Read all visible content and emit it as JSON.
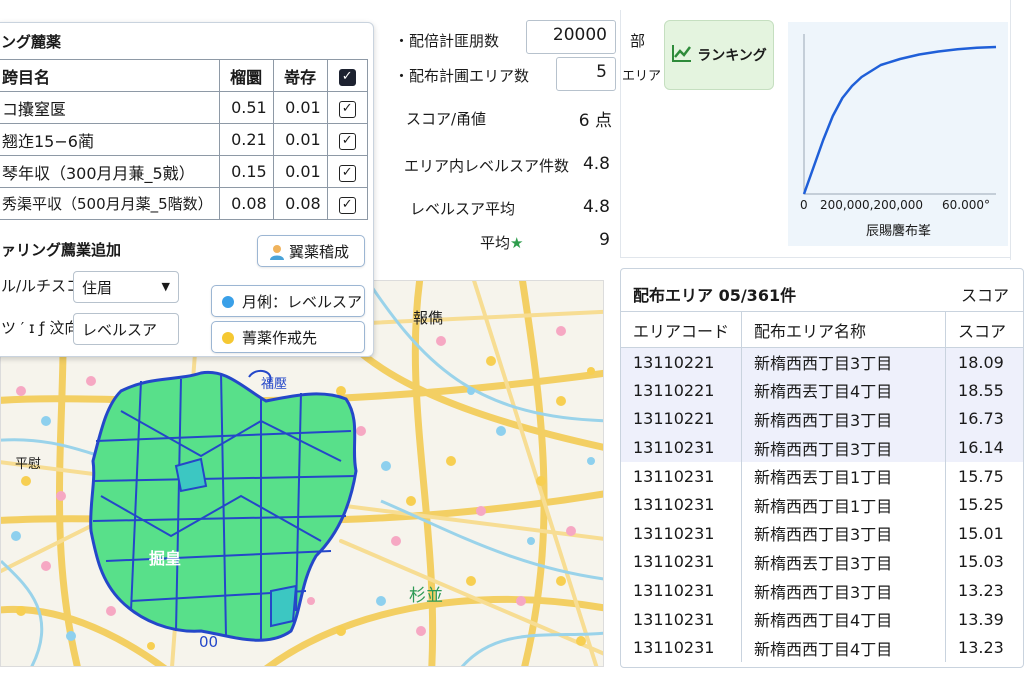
{
  "factor_panel": {
    "title": "ング麓薬",
    "headers": [
      "跨目名",
      "榴圜",
      "嵜存"
    ],
    "rows": [
      {
        "name": "コ攮窒匽",
        "weight": "0.51",
        "std": "0.01",
        "checked": true
      },
      {
        "name": "翘迮15−6蔺",
        "weight": "0.21",
        "std": "0.01",
        "checked": true
      },
      {
        "name": "琴年収（300月月蒹_5戭）",
        "weight": "0.15",
        "std": "0.01",
        "checked": true
      },
      {
        "name": "秀渠平収（500月月薬_5階数）",
        "weight": "0.08",
        "std": "0.08",
        "checked": true
      }
    ],
    "add_title": "ァリング薦業追加",
    "add_button": "翼薬稽成",
    "field1_label": "ル/ルチスコ",
    "field1_value": "住眉",
    "field2_label": "ツ ′ ɪ ƒ 汶向",
    "field2_value": "レベルスア",
    "btn_blue": "月俐：レベルスア",
    "btn_yellow": "菁薬作戒先"
  },
  "settings": {
    "plan_label": "・配倍計匪朋数",
    "plan_value": "20000",
    "plan_unit": "部",
    "area_label": "・配布計圃エリア数",
    "area_value": "5",
    "area_unit": "エリア",
    "score_label": "スコア/甬値",
    "score_value": "6 点",
    "count_label": "エリア内レベルスア件数",
    "count_value": "4.8",
    "avg_label": "レベルスア平均",
    "avg_value": "4.8",
    "star_label": "平均★",
    "star_value": "9"
  },
  "ranking_button": "ランキング",
  "chart_data": {
    "type": "line",
    "xtick_labels": [
      "0",
      "200,000,200,000",
      "60.000°"
    ],
    "xlabel": "辰賜麐布峯",
    "x": [
      0,
      5,
      10,
      15,
      20,
      25,
      30,
      40,
      50,
      60,
      70,
      80,
      90,
      100
    ],
    "y": [
      0,
      18,
      36,
      52,
      64,
      72,
      78,
      86,
      90,
      93,
      95,
      96.5,
      97.5,
      98
    ],
    "ylim": [
      0,
      100
    ],
    "line_color": "#1f5fd8"
  },
  "map": {
    "labels": [
      "報儁",
      "福壓",
      "平慰",
      "掘皇",
      "杉並",
      "00"
    ]
  },
  "results": {
    "title": "配布エリア 05/361件",
    "score_header": "スコア",
    "columns": [
      "エリアコード",
      "配布エリア名称",
      "スコア"
    ],
    "rows": [
      {
        "code": "13110221",
        "name": "新楕西西丁目3丁目",
        "score": "18.09",
        "hl": true
      },
      {
        "code": "13110221",
        "name": "新楕西丟丁目4丁目",
        "score": "18.55",
        "hl": true
      },
      {
        "code": "13110221",
        "name": "新楕西西丁目3丁目",
        "score": "16.73",
        "hl": true
      },
      {
        "code": "13110231",
        "name": "新楕西西丁目3丁目",
        "score": "16.14",
        "hl": true
      },
      {
        "code": "13110231",
        "name": "新楕西丟丁目1丁目",
        "score": "15.75",
        "hl": false
      },
      {
        "code": "13110231",
        "name": "新楕西西丁目1丁目",
        "score": "15.25",
        "hl": false
      },
      {
        "code": "13110231",
        "name": "新楕西西丁目3丁目",
        "score": "15.01",
        "hl": false
      },
      {
        "code": "13110231",
        "name": "新楕西丟丁目3丁目",
        "score": "15.03",
        "hl": false
      },
      {
        "code": "13110231",
        "name": "新楕西西丁目3丁目",
        "score": "13.23",
        "hl": false
      },
      {
        "code": "13110231",
        "name": "新楕西西丁目4丁目",
        "score": "13.39",
        "hl": false
      },
      {
        "code": "13110231",
        "name": "新楕西西丁目4丁目",
        "score": "13.23",
        "hl": false
      }
    ]
  }
}
